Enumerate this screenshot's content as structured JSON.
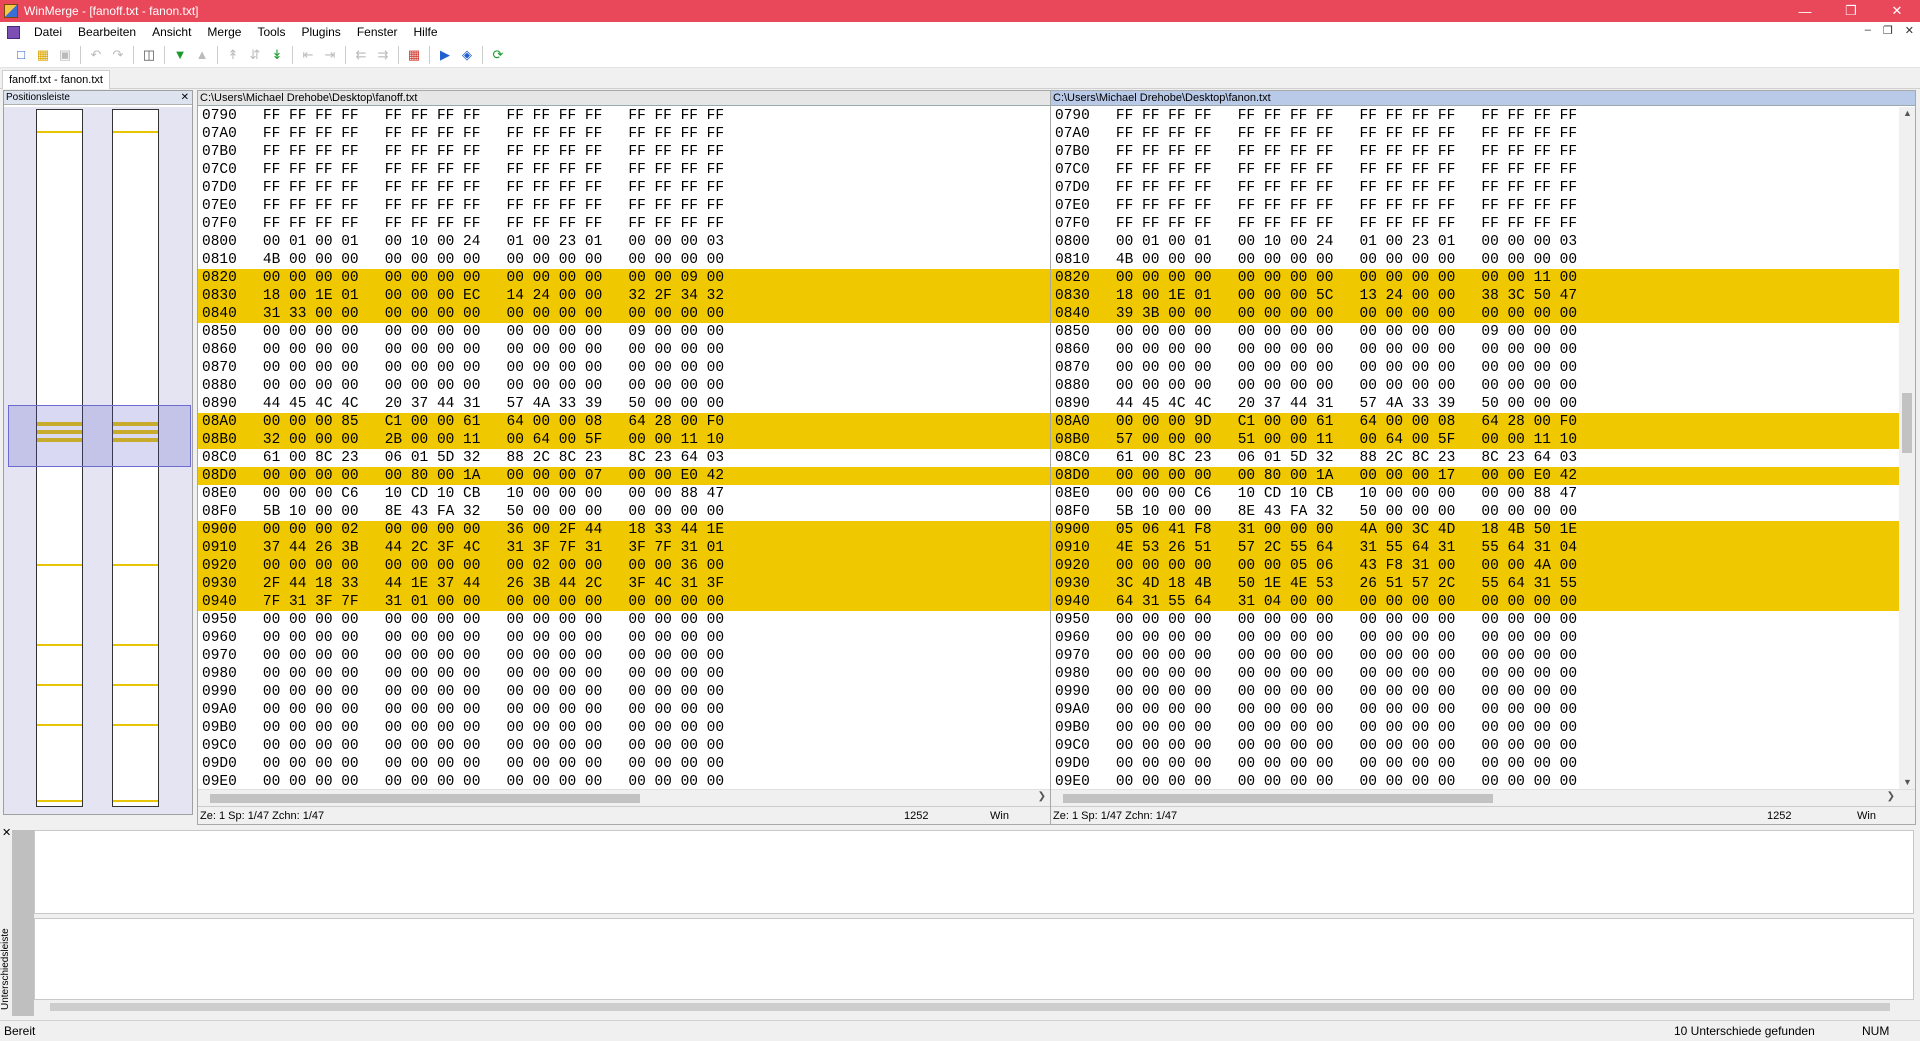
{
  "window": {
    "title": "WinMerge - [fanoff.txt - fanon.txt]",
    "controls": [
      "minimize-icon",
      "restore-icon",
      "close-icon"
    ]
  },
  "menu": [
    "Datei",
    "Bearbeiten",
    "Ansicht",
    "Merge",
    "Tools",
    "Plugins",
    "Fenster",
    "Hilfe"
  ],
  "toolbar_icons": [
    "new-icon",
    "open-icon",
    "save-icon",
    "undo-icon",
    "redo-icon",
    "diff-pane-icon",
    "next-diff-icon",
    "prev-diff-icon",
    "first-diff-icon",
    "current-diff-icon",
    "last-diff-icon",
    "copy-left-icon",
    "copy-right-icon",
    "copy-all-left-icon",
    "copy-all-right-icon",
    "options-icon",
    "compare-icon",
    "refresh-icon",
    "sync-icon"
  ],
  "tab": "fanoff.txt - fanon.txt",
  "location_pane": {
    "title": "Positionsleiste"
  },
  "left_pane": {
    "path": "C:\\Users\\Michael Drehobe\\Desktop\\fanoff.txt",
    "status": {
      "pos": "Ze: 1  Sp: 1/47  Zchn: 1/47",
      "codepage": "1252",
      "eol": "Win"
    }
  },
  "right_pane": {
    "path": "C:\\Users\\Michael Drehobe\\Desktop\\fanon.txt",
    "status": {
      "pos": "Ze: 1  Sp: 1/47  Zchn: 1/47",
      "codepage": "1252",
      "eol": "Win"
    }
  },
  "left_lines": [
    {
      "t": "0790   FF FF FF FF   FF FF FF FF   FF FF FF FF   FF FF FF FF",
      "d": false
    },
    {
      "t": "07A0   FF FF FF FF   FF FF FF FF   FF FF FF FF   FF FF FF FF",
      "d": false
    },
    {
      "t": "07B0   FF FF FF FF   FF FF FF FF   FF FF FF FF   FF FF FF FF",
      "d": false
    },
    {
      "t": "07C0   FF FF FF FF   FF FF FF FF   FF FF FF FF   FF FF FF FF",
      "d": false
    },
    {
      "t": "07D0   FF FF FF FF   FF FF FF FF   FF FF FF FF   FF FF FF FF",
      "d": false
    },
    {
      "t": "07E0   FF FF FF FF   FF FF FF FF   FF FF FF FF   FF FF FF FF",
      "d": false
    },
    {
      "t": "07F0   FF FF FF FF   FF FF FF FF   FF FF FF FF   FF FF FF FF",
      "d": false
    },
    {
      "t": "0800   00 01 00 01   00 10 00 24   01 00 23 01   00 00 00 03",
      "d": false
    },
    {
      "t": "0810   4B 00 00 00   00 00 00 00   00 00 00 00   00 00 00 00",
      "d": false
    },
    {
      "t": "0820   00 00 00 00   00 00 00 00   00 00 00 00   00 00 09 00",
      "d": true
    },
    {
      "t": "0830   18 00 1E 01   00 00 00 EC   14 24 00 00   32 2F 34 32",
      "d": true
    },
    {
      "t": "0840   31 33 00 00   00 00 00 00   00 00 00 00   00 00 00 00",
      "d": true
    },
    {
      "t": "0850   00 00 00 00   00 00 00 00   00 00 00 00   09 00 00 00",
      "d": false
    },
    {
      "t": "0860   00 00 00 00   00 00 00 00   00 00 00 00   00 00 00 00",
      "d": false
    },
    {
      "t": "0870   00 00 00 00   00 00 00 00   00 00 00 00   00 00 00 00",
      "d": false
    },
    {
      "t": "0880   00 00 00 00   00 00 00 00   00 00 00 00   00 00 00 00",
      "d": false
    },
    {
      "t": "0890   44 45 4C 4C   20 37 44 31   57 4A 33 39   50 00 00 00",
      "d": false
    },
    {
      "t": "08A0   00 00 00 85   C1 00 00 61   64 00 00 08   64 28 00 F0",
      "d": true
    },
    {
      "t": "08B0   32 00 00 00   2B 00 00 11   00 64 00 5F   00 00 11 10",
      "d": true
    },
    {
      "t": "08C0   61 00 8C 23   06 01 5D 32   88 2C 8C 23   8C 23 64 03",
      "d": false
    },
    {
      "t": "08D0   00 00 00 00   00 80 00 1A   00 00 00 07   00 00 E0 42",
      "d": true
    },
    {
      "t": "08E0   00 00 00 C6   10 CD 10 CB   10 00 00 00   00 00 88 47",
      "d": false
    },
    {
      "t": "08F0   5B 10 00 00   8E 43 FA 32   50 00 00 00   00 00 00 00",
      "d": false
    },
    {
      "t": "0900   00 00 00 02   00 00 00 00   36 00 2F 44   18 33 44 1E",
      "d": true
    },
    {
      "t": "0910   37 44 26 3B   44 2C 3F 4C   31 3F 7F 31   3F 7F 31 01",
      "d": true
    },
    {
      "t": "0920   00 00 00 00   00 00 00 00   00 02 00 00   00 00 36 00",
      "d": true
    },
    {
      "t": "0930   2F 44 18 33   44 1E 37 44   26 3B 44 2C   3F 4C 31 3F",
      "d": true
    },
    {
      "t": "0940   7F 31 3F 7F   31 01 00 00   00 00 00 00   00 00 00 00",
      "d": true
    },
    {
      "t": "0950   00 00 00 00   00 00 00 00   00 00 00 00   00 00 00 00",
      "d": false
    },
    {
      "t": "0960   00 00 00 00   00 00 00 00   00 00 00 00   00 00 00 00",
      "d": false
    },
    {
      "t": "0970   00 00 00 00   00 00 00 00   00 00 00 00   00 00 00 00",
      "d": false
    },
    {
      "t": "0980   00 00 00 00   00 00 00 00   00 00 00 00   00 00 00 00",
      "d": false
    },
    {
      "t": "0990   00 00 00 00   00 00 00 00   00 00 00 00   00 00 00 00",
      "d": false
    },
    {
      "t": "09A0   00 00 00 00   00 00 00 00   00 00 00 00   00 00 00 00",
      "d": false
    },
    {
      "t": "09B0   00 00 00 00   00 00 00 00   00 00 00 00   00 00 00 00",
      "d": false
    },
    {
      "t": "09C0   00 00 00 00   00 00 00 00   00 00 00 00   00 00 00 00",
      "d": false
    },
    {
      "t": "09D0   00 00 00 00   00 00 00 00   00 00 00 00   00 00 00 00",
      "d": false
    },
    {
      "t": "09E0   00 00 00 00   00 00 00 00   00 00 00 00   00 00 00 00",
      "d": false
    }
  ],
  "right_lines": [
    {
      "t": "0790   FF FF FF FF   FF FF FF FF   FF FF FF FF   FF FF FF FF",
      "d": false
    },
    {
      "t": "07A0   FF FF FF FF   FF FF FF FF   FF FF FF FF   FF FF FF FF",
      "d": false
    },
    {
      "t": "07B0   FF FF FF FF   FF FF FF FF   FF FF FF FF   FF FF FF FF",
      "d": false
    },
    {
      "t": "07C0   FF FF FF FF   FF FF FF FF   FF FF FF FF   FF FF FF FF",
      "d": false
    },
    {
      "t": "07D0   FF FF FF FF   FF FF FF FF   FF FF FF FF   FF FF FF FF",
      "d": false
    },
    {
      "t": "07E0   FF FF FF FF   FF FF FF FF   FF FF FF FF   FF FF FF FF",
      "d": false
    },
    {
      "t": "07F0   FF FF FF FF   FF FF FF FF   FF FF FF FF   FF FF FF FF",
      "d": false
    },
    {
      "t": "0800   00 01 00 01   00 10 00 24   01 00 23 01   00 00 00 03",
      "d": false
    },
    {
      "t": "0810   4B 00 00 00   00 00 00 00   00 00 00 00   00 00 00 00",
      "d": false
    },
    {
      "t": "0820   00 00 00 00   00 00 00 00   00 00 00 00   00 00 11 00",
      "d": true
    },
    {
      "t": "0830   18 00 1E 01   00 00 00 5C   13 24 00 00   38 3C 50 47",
      "d": true
    },
    {
      "t": "0840   39 3B 00 00   00 00 00 00   00 00 00 00   00 00 00 00",
      "d": true
    },
    {
      "t": "0850   00 00 00 00   00 00 00 00   00 00 00 00   09 00 00 00",
      "d": false
    },
    {
      "t": "0860   00 00 00 00   00 00 00 00   00 00 00 00   00 00 00 00",
      "d": false
    },
    {
      "t": "0870   00 00 00 00   00 00 00 00   00 00 00 00   00 00 00 00",
      "d": false
    },
    {
      "t": "0880   00 00 00 00   00 00 00 00   00 00 00 00   00 00 00 00",
      "d": false
    },
    {
      "t": "0890   44 45 4C 4C   20 37 44 31   57 4A 33 39   50 00 00 00",
      "d": false
    },
    {
      "t": "08A0   00 00 00 9D   C1 00 00 61   64 00 00 08   64 28 00 F0",
      "d": true
    },
    {
      "t": "08B0   57 00 00 00   51 00 00 11   00 64 00 5F   00 00 11 10",
      "d": true
    },
    {
      "t": "08C0   61 00 8C 23   06 01 5D 32   88 2C 8C 23   8C 23 64 03",
      "d": false
    },
    {
      "t": "08D0   00 00 00 00   00 80 00 1A   00 00 00 17   00 00 E0 42",
      "d": true
    },
    {
      "t": "08E0   00 00 00 C6   10 CD 10 CB   10 00 00 00   00 00 88 47",
      "d": false
    },
    {
      "t": "08F0   5B 10 00 00   8E 43 FA 32   50 00 00 00   00 00 00 00",
      "d": false
    },
    {
      "t": "0900   05 06 41 F8   31 00 00 00   4A 00 3C 4D   18 4B 50 1E",
      "d": true
    },
    {
      "t": "0910   4E 53 26 51   57 2C 55 64   31 55 64 31   55 64 31 04",
      "d": true
    },
    {
      "t": "0920   00 00 00 00   00 00 05 06   43 F8 31 00   00 00 4A 00",
      "d": true
    },
    {
      "t": "0930   3C 4D 18 4B   50 1E 4E 53   26 51 57 2C   55 64 31 55",
      "d": true
    },
    {
      "t": "0940   64 31 55 64   31 04 00 00   00 00 00 00   00 00 00 00",
      "d": true
    },
    {
      "t": "0950   00 00 00 00   00 00 00 00   00 00 00 00   00 00 00 00",
      "d": false
    },
    {
      "t": "0960   00 00 00 00   00 00 00 00   00 00 00 00   00 00 00 00",
      "d": false
    },
    {
      "t": "0970   00 00 00 00   00 00 00 00   00 00 00 00   00 00 00 00",
      "d": false
    },
    {
      "t": "0980   00 00 00 00   00 00 00 00   00 00 00 00   00 00 00 00",
      "d": false
    },
    {
      "t": "0990   00 00 00 00   00 00 00 00   00 00 00 00   00 00 00 00",
      "d": false
    },
    {
      "t": "09A0   00 00 00 00   00 00 00 00   00 00 00 00   00 00 00 00",
      "d": false
    },
    {
      "t": "09B0   00 00 00 00   00 00 00 00   00 00 00 00   00 00 00 00",
      "d": false
    },
    {
      "t": "09C0   00 00 00 00   00 00 00 00   00 00 00 00   00 00 00 00",
      "d": false
    },
    {
      "t": "09D0   00 00 00 00   00 00 00 00   00 00 00 00   00 00 00 00",
      "d": false
    },
    {
      "t": "09E0   00 00 00 00   00 00 00 00   00 00 00 00   00 00 00 00",
      "d": false
    }
  ],
  "diff_pane": {
    "label": "Unterschiedsleiste"
  },
  "status": {
    "left": "Bereit",
    "diffs": "10 Unterschiede gefunden",
    "num": "NUM"
  },
  "colors": {
    "title_bar": "#e8485a",
    "diff": "#efc800",
    "word_diff": "#f6e7a9",
    "right_header": "#b9c9e8"
  }
}
